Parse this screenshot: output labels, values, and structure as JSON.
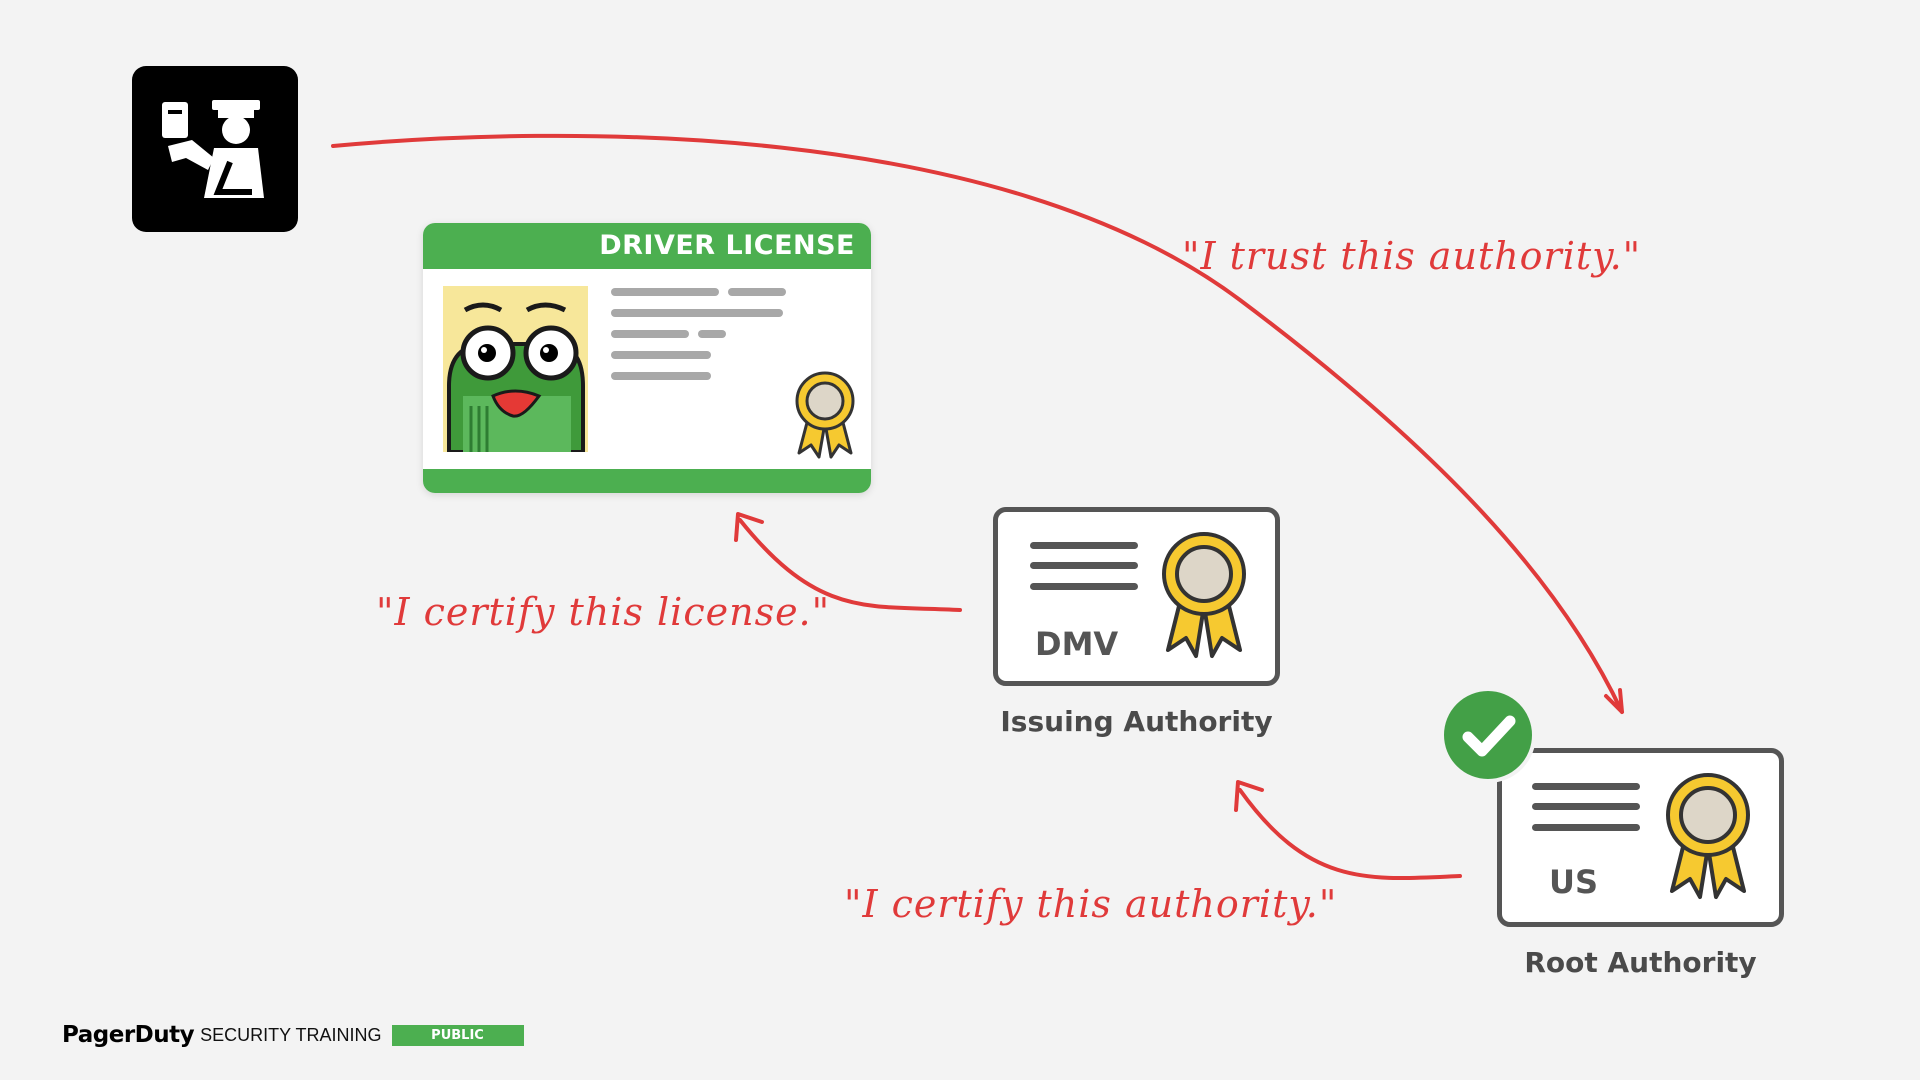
{
  "license": {
    "title": "DRIVER LICENSE"
  },
  "issuing": {
    "cert_label": "DMV",
    "caption": "Issuing Authority"
  },
  "root": {
    "cert_label": "US",
    "caption": "Root Authority"
  },
  "notes": {
    "trust": "\"I trust this authority.\"",
    "certify_license": "\"I certify this license.\"",
    "certify_authority": "\"I certify this authority.\""
  },
  "footer": {
    "brand": "PagerDuty",
    "subtitle": "SECURITY TRAINING",
    "badge": "PUBLIC"
  },
  "icons": [
    "passport-control-officer-icon",
    "frog-mascot-photo",
    "award-ribbon-icon",
    "checkmark-icon"
  ],
  "colors": {
    "accent_green": "#4caf50",
    "arrow_red": "#e03a3a",
    "dark_gray": "#555555",
    "background": "#f3f3f3"
  }
}
